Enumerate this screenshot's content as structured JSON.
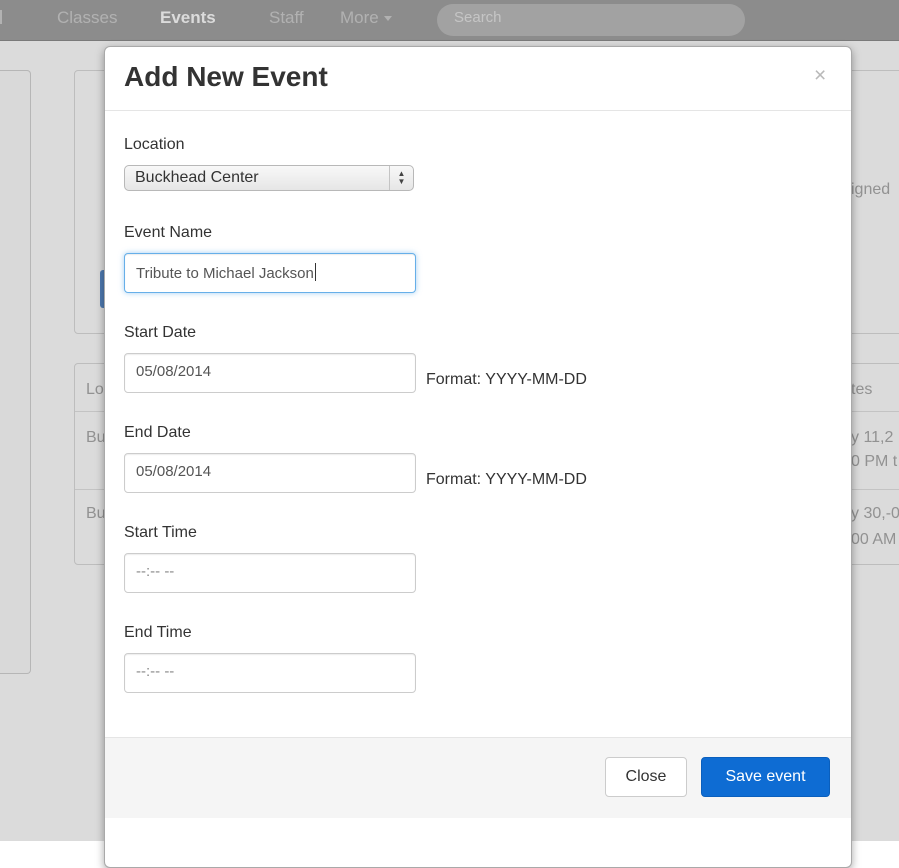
{
  "navbar": {
    "items": [
      {
        "label": "Classes",
        "active": false
      },
      {
        "label": "Events",
        "active": true
      },
      {
        "label": "Staff",
        "active": false
      },
      {
        "label": "More",
        "active": false
      }
    ],
    "search_placeholder": "Search"
  },
  "background": {
    "panel_text_fragment": "igned",
    "table": {
      "header_left": "Lo",
      "header_right": "tes",
      "rows": [
        {
          "left": "Bu",
          "right_line1": "y 11,2",
          "right_line2": "0 PM t"
        },
        {
          "left": "Bu",
          "right_line1": "y 30,-0",
          "right_line2": "00 AM"
        }
      ]
    }
  },
  "modal": {
    "title": "Add New Event",
    "close_symbol": "×",
    "fields": {
      "location": {
        "label": "Location",
        "selected": "Buckhead Center"
      },
      "event_name": {
        "label": "Event Name",
        "value": "Tribute to Michael Jackson"
      },
      "start_date": {
        "label": "Start Date",
        "value": "05/08/2014",
        "hint": "Format: YYYY-MM-DD"
      },
      "end_date": {
        "label": "End Date",
        "value": "05/08/2014",
        "hint": "Format: YYYY-MM-DD"
      },
      "start_time": {
        "label": "Start Time",
        "value": "--:-- --"
      },
      "end_time": {
        "label": "End Time",
        "value": "--:-- --"
      }
    },
    "buttons": {
      "close_label": "Close",
      "save_label": "Save event"
    }
  },
  "colors": {
    "primary": "#0e6cd3",
    "focus_ring": "#66afe9",
    "navbar": "#a4a4a4"
  }
}
